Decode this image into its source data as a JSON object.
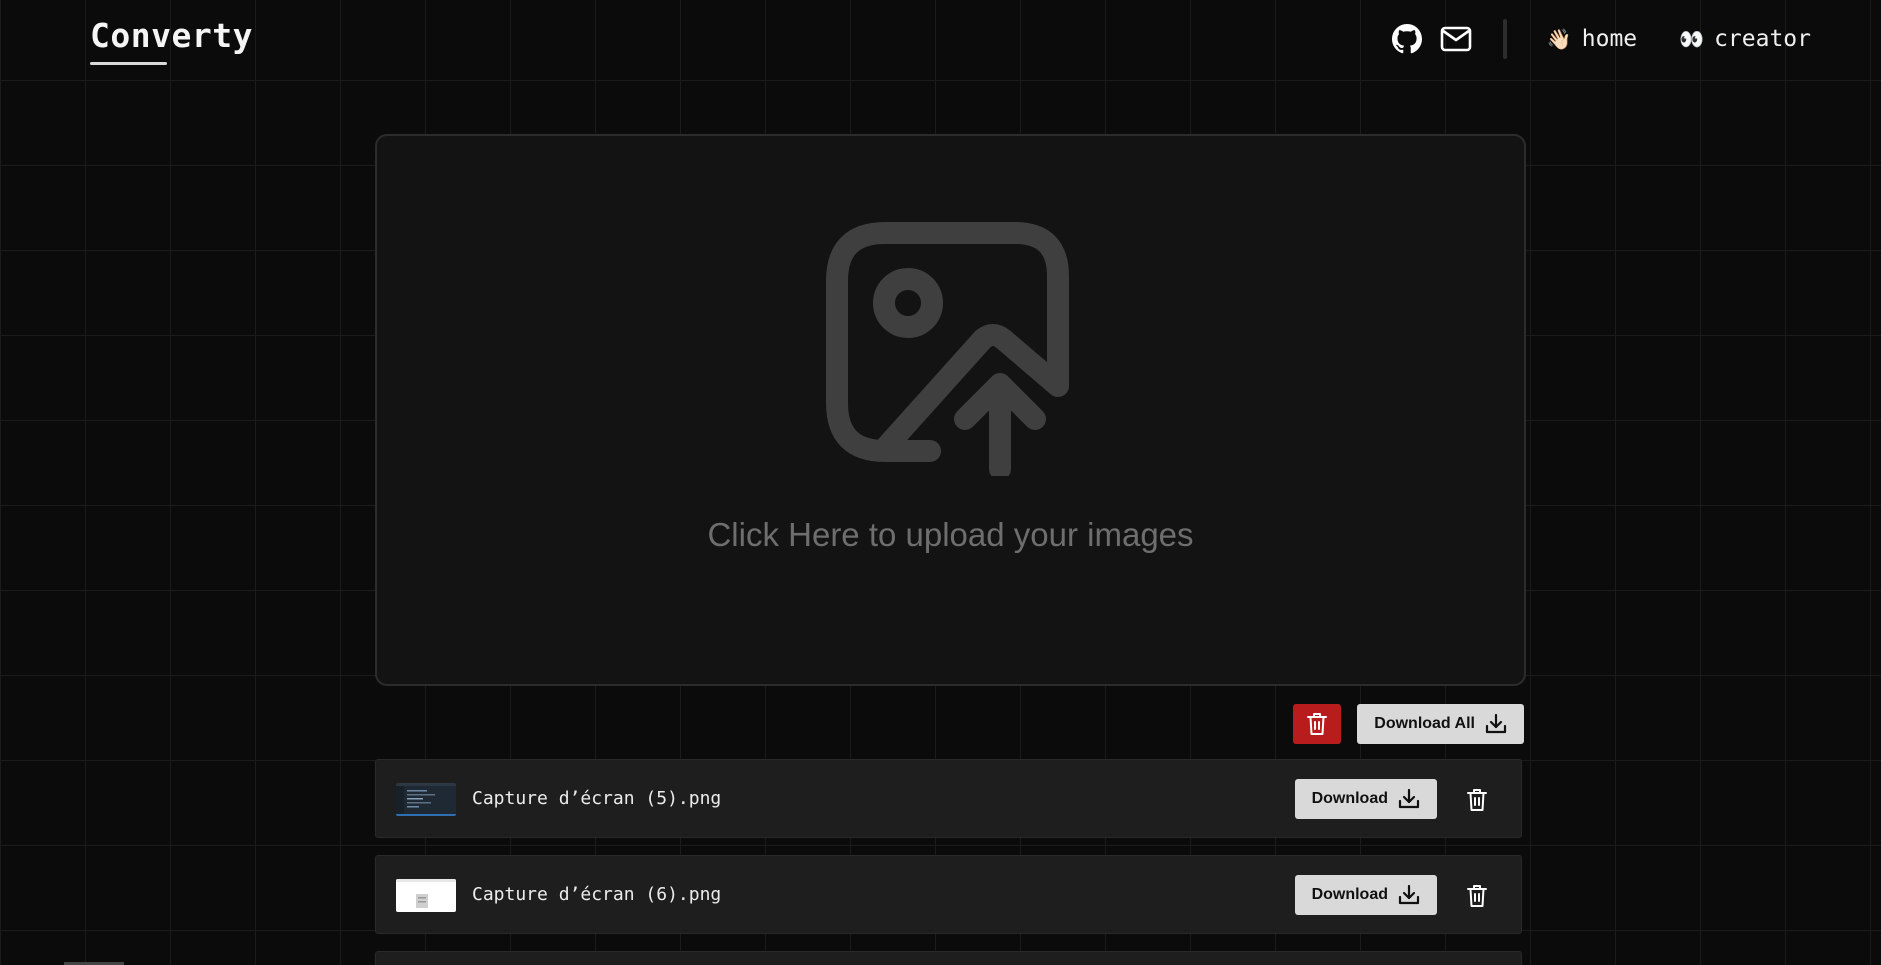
{
  "app": {
    "logo": "Converty"
  },
  "nav": {
    "icons": [
      "github-icon",
      "mail-icon"
    ],
    "links": [
      {
        "emoji": "👋🏻",
        "label": "home"
      },
      {
        "emoji": "👀",
        "label": "creator"
      }
    ]
  },
  "upload": {
    "text": "Click Here to upload your images"
  },
  "actions": {
    "download_all_label": "Download All"
  },
  "files": [
    {
      "name": "Capture d’écran (5).png",
      "download_label": "Download"
    },
    {
      "name": "Capture d’écran (6).png",
      "download_label": "Download"
    }
  ],
  "colors": {
    "background": "#0b0b0b",
    "danger": "#b91c1c",
    "button_light": "#d9d9d9",
    "panel": "#131313"
  }
}
